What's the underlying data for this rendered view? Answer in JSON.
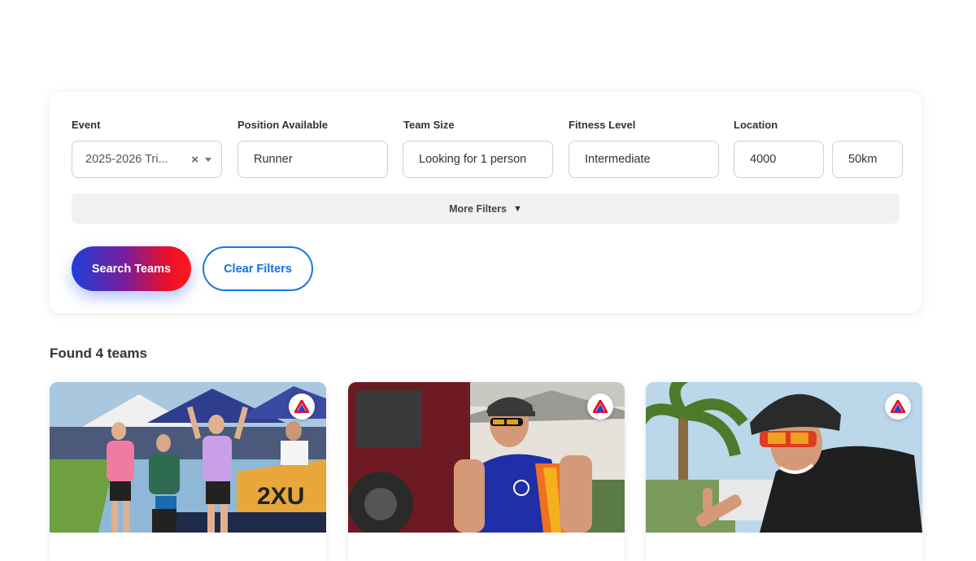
{
  "filters": {
    "event": {
      "label": "Event",
      "value": "2025-2026 Tri...",
      "clear_icon": "×"
    },
    "position": {
      "label": "Position Available",
      "value": "Runner"
    },
    "team_size": {
      "label": "Team Size",
      "value": "Looking for 1 person"
    },
    "fitness_level": {
      "label": "Fitness Level",
      "value": "Intermediate"
    },
    "location": {
      "label": "Location",
      "postcode": "4000",
      "radius": "50km"
    },
    "more_filters_label": "More Filters",
    "more_filters_icon": "▼"
  },
  "actions": {
    "search_label": "Search Teams",
    "clear_label": "Clear Filters"
  },
  "results": {
    "count_label": "Found 4 teams"
  },
  "cards": [
    {
      "image": "triathlon-finish-line-photo",
      "badge_icon": "team-logo-icon"
    },
    {
      "image": "runner-in-trisuit-photo",
      "badge_icon": "team-logo-icon"
    },
    {
      "image": "cyclist-with-helmet-photo",
      "badge_icon": "team-logo-icon"
    }
  ],
  "colors": {
    "primary_blue": "#1476e6",
    "gradient_start": "#1e3fd8",
    "gradient_end": "#ff1a1a",
    "text_dark": "#333333"
  }
}
